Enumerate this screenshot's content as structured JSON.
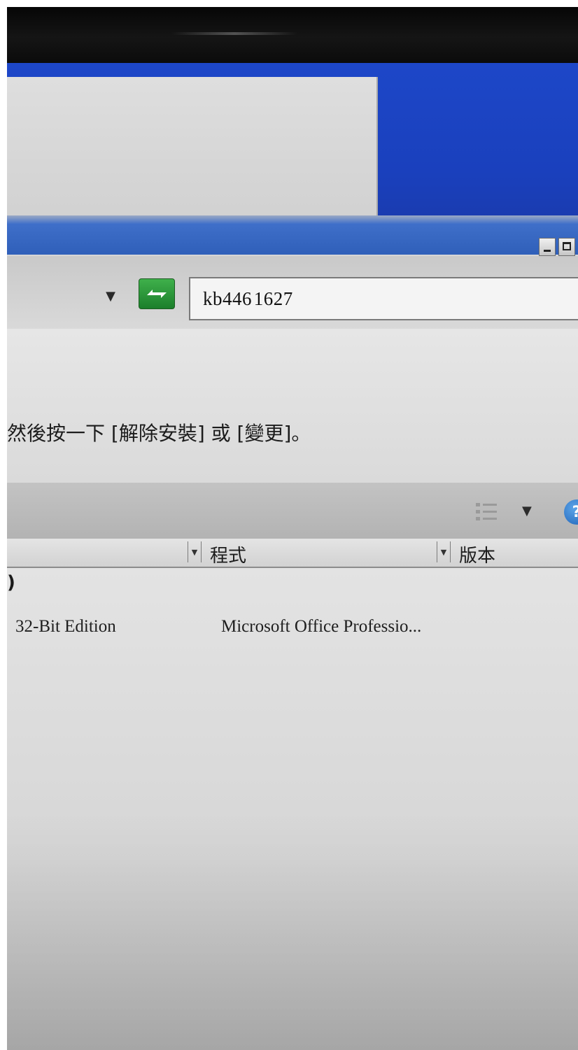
{
  "address": {
    "dropdown_glyph": "▼",
    "refresh_icon": "refresh-arrows-icon"
  },
  "search": {
    "value": "kb446 1627"
  },
  "instruction": {
    "text": "然後按一下 [解除安裝] 或 [變更]。"
  },
  "toolbar": {
    "view_icon": "view-options-icon",
    "view_dropdown_glyph": "▼",
    "help_label": "?"
  },
  "columns": [
    {
      "label": ""
    },
    {
      "label": "程式"
    },
    {
      "label": "版本"
    }
  ],
  "list": {
    "group_fragment": ")",
    "rows": [
      {
        "name": "32-Bit Edition",
        "program": "Microsoft Office Professio..."
      }
    ]
  },
  "colors": {
    "desktop_blue": "#1d47c8",
    "titlebar_blue": "#2f5fb9",
    "refresh_green": "#1b7f2b",
    "window_gray": "#d9d9d9"
  }
}
